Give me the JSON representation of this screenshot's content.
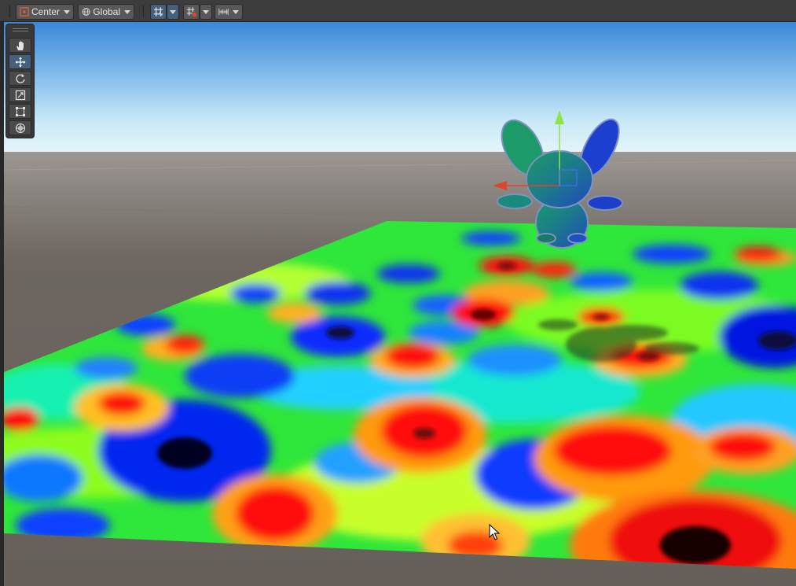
{
  "toolbar": {
    "pivot_mode": {
      "label": "Center",
      "icon": "pivot-center-icon"
    },
    "pivot_rotation": {
      "label": "Global",
      "icon": "globe-icon"
    },
    "grid_snap": {
      "icon": "grid-snap-icon",
      "active": true
    },
    "increment_snap": {
      "icon": "increment-snap-icon",
      "active": false
    },
    "ruler": {
      "icon": "ruler-icon"
    }
  },
  "tools": [
    {
      "name": "hand-tool",
      "icon": "hand-icon",
      "active": false
    },
    {
      "name": "move-tool",
      "icon": "move-arrows-icon",
      "active": true
    },
    {
      "name": "rotate-tool",
      "icon": "rotate-icon",
      "active": false
    },
    {
      "name": "scale-tool",
      "icon": "scale-icon",
      "active": false
    },
    {
      "name": "rect-tool",
      "icon": "rect-transform-icon",
      "active": false
    },
    {
      "name": "transform-tool",
      "icon": "transform-icon",
      "active": false
    }
  ],
  "colors": {
    "toolbar_bg": "#3c3c3c",
    "button_bg": "#585858",
    "active_blue": "#46607c",
    "sky_top": "#3a88d8",
    "sky_horizon": "#e8f6fb",
    "ground": "#6a635e",
    "gizmo_x": "#e0452d",
    "gizmo_y": "#8ee34a"
  },
  "scene": {
    "selected_object": "bunny",
    "heatmap_palette": [
      "#000014",
      "#0000ff",
      "#00ffff",
      "#00ff00",
      "#ffff00",
      "#ff8000",
      "#ff0000",
      "#200000"
    ]
  }
}
